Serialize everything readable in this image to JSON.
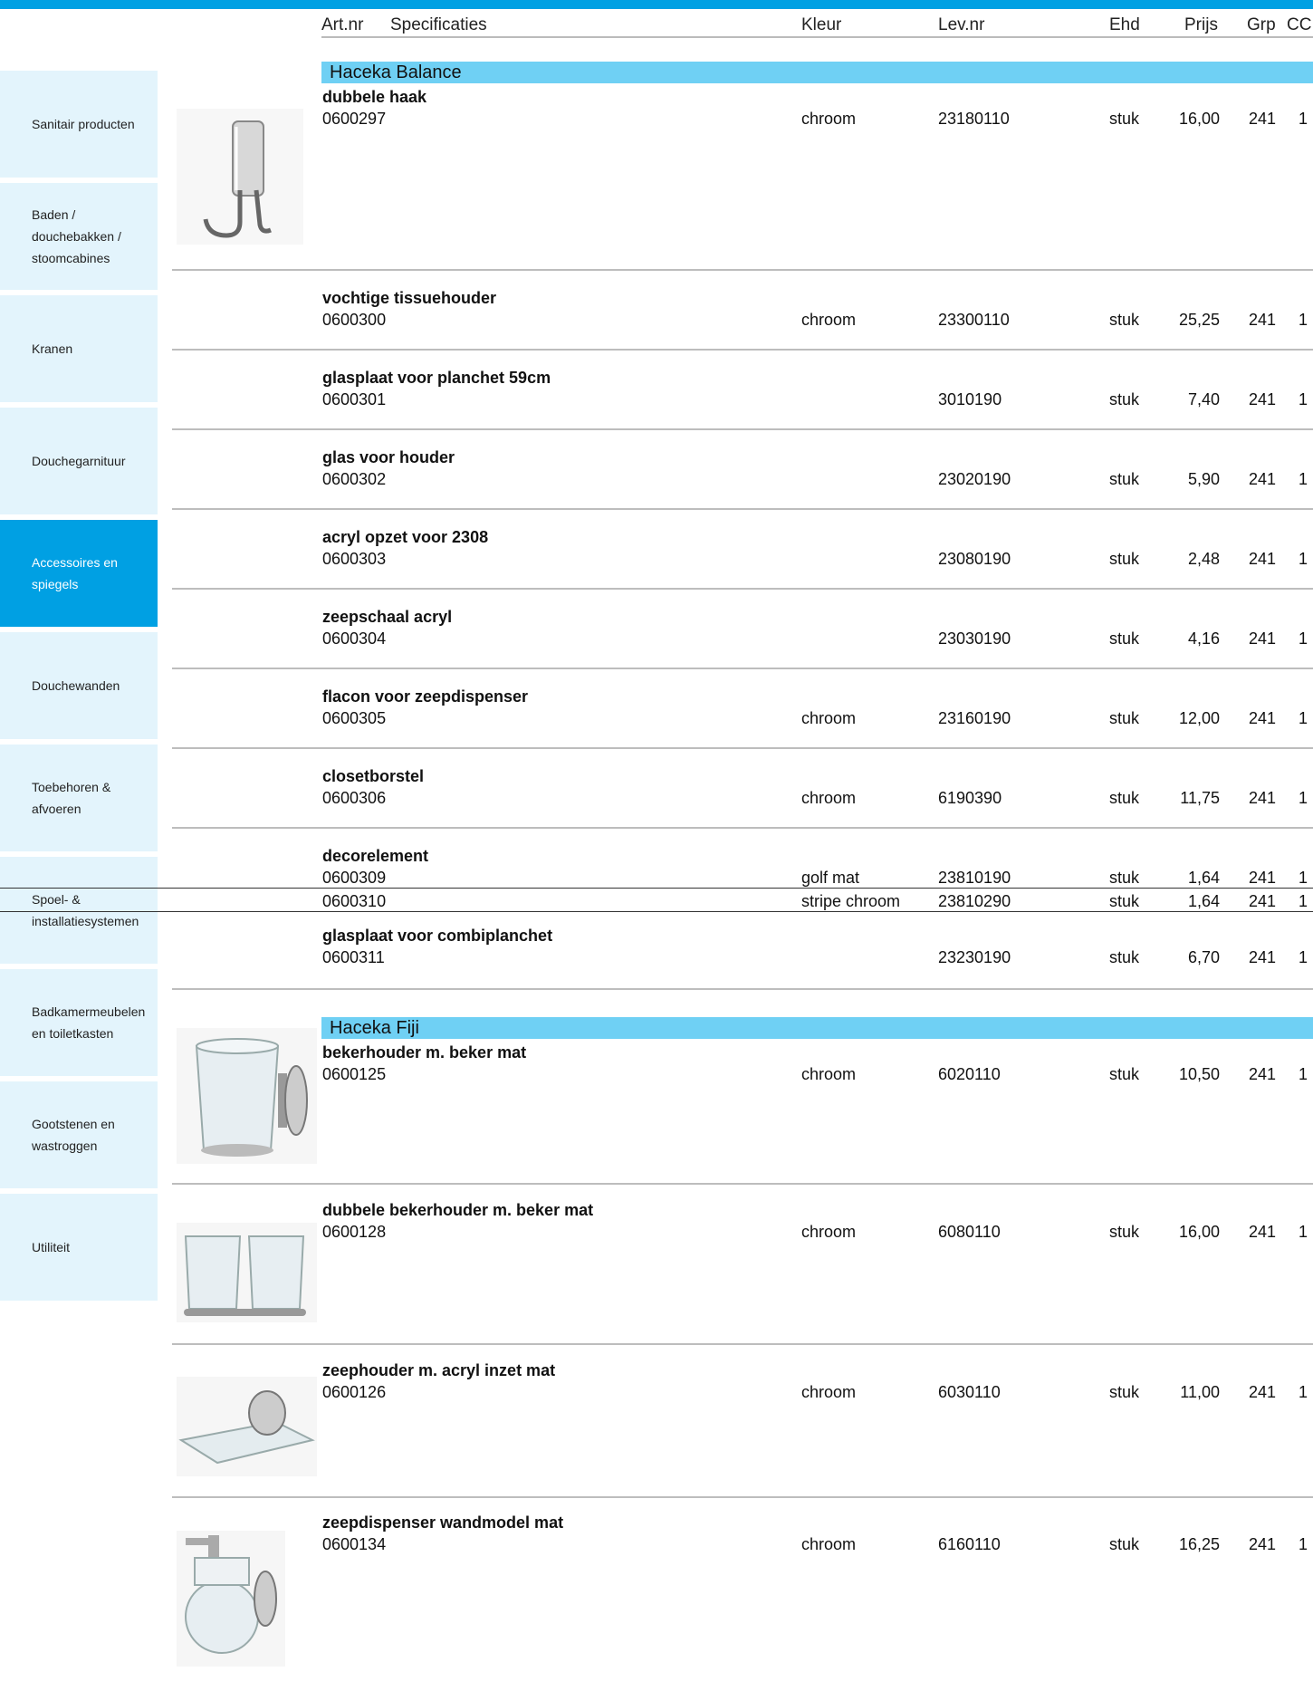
{
  "header": {
    "art_nr": "Art.nr",
    "specificaties": "Specificaties",
    "kleur": "Kleur",
    "lev_nr": "Lev.nr",
    "ehd": "Ehd",
    "prijs": "Prijs",
    "grp": "Grp",
    "cc": "CC"
  },
  "sidebar": {
    "items": [
      {
        "label": "Sanitair producten",
        "active": false
      },
      {
        "label": "Baden /\ndouchebakken /\nstoomcabines",
        "active": false
      },
      {
        "label": "Kranen",
        "active": false
      },
      {
        "label": "Douchegarnituur",
        "active": false
      },
      {
        "label": "Accessoires en\nspiegels",
        "active": true
      },
      {
        "label": "Douchewanden",
        "active": false
      },
      {
        "label": "Toebehoren &\nafvoeren",
        "active": false
      },
      {
        "label": "Spoel- &\ninstallatiesystemen",
        "active": false
      },
      {
        "label": "Badkamermeubelen\nen toiletkasten",
        "active": false
      },
      {
        "label": "Gootstenen en\nwastroggen",
        "active": false
      },
      {
        "label": "Utiliteit",
        "active": false
      }
    ]
  },
  "groups": [
    {
      "name": "Haceka Balance",
      "products": [
        {
          "title": "dubbele haak",
          "image": "hook-icon",
          "rows": [
            {
              "art": "0600297",
              "kleur": "chroom",
              "lev": "23180110",
              "ehd": "stuk",
              "prijs": "16,00",
              "grp": "241",
              "cc": "1"
            }
          ]
        },
        {
          "title": "vochtige tissuehouder",
          "rows": [
            {
              "art": "0600300",
              "kleur": "chroom",
              "lev": "23300110",
              "ehd": "stuk",
              "prijs": "25,25",
              "grp": "241",
              "cc": "1"
            }
          ]
        },
        {
          "title": "glasplaat voor planchet 59cm",
          "rows": [
            {
              "art": "0600301",
              "kleur": "",
              "lev": "3010190",
              "ehd": "stuk",
              "prijs": "7,40",
              "grp": "241",
              "cc": "1"
            }
          ]
        },
        {
          "title": "glas voor houder",
          "rows": [
            {
              "art": "0600302",
              "kleur": "",
              "lev": "23020190",
              "ehd": "stuk",
              "prijs": "5,90",
              "grp": "241",
              "cc": "1"
            }
          ]
        },
        {
          "title": "acryl opzet voor 2308",
          "rows": [
            {
              "art": "0600303",
              "kleur": "",
              "lev": "23080190",
              "ehd": "stuk",
              "prijs": "2,48",
              "grp": "241",
              "cc": "1"
            }
          ]
        },
        {
          "title": "zeepschaal acryl",
          "rows": [
            {
              "art": "0600304",
              "kleur": "",
              "lev": "23030190",
              "ehd": "stuk",
              "prijs": "4,16",
              "grp": "241",
              "cc": "1"
            }
          ]
        },
        {
          "title": "flacon voor zeepdispenser",
          "rows": [
            {
              "art": "0600305",
              "kleur": "chroom",
              "lev": "23160190",
              "ehd": "stuk",
              "prijs": "12,00",
              "grp": "241",
              "cc": "1"
            }
          ]
        },
        {
          "title": "closetborstel",
          "rows": [
            {
              "art": "0600306",
              "kleur": "chroom",
              "lev": "6190390",
              "ehd": "stuk",
              "prijs": "11,75",
              "grp": "241",
              "cc": "1"
            }
          ]
        },
        {
          "title": "decorelement",
          "rows": [
            {
              "art": "0600309",
              "kleur": "golf mat",
              "lev": "23810190",
              "ehd": "stuk",
              "prijs": "1,64",
              "grp": "241",
              "cc": "1"
            },
            {
              "art": "0600310",
              "kleur": "stripe chroom",
              "lev": "23810290",
              "ehd": "stuk",
              "prijs": "1,64",
              "grp": "241",
              "cc": "1"
            }
          ]
        },
        {
          "title": "glasplaat voor combiplanchet",
          "rows": [
            {
              "art": "0600311",
              "kleur": "",
              "lev": "23230190",
              "ehd": "stuk",
              "prijs": "6,70",
              "grp": "241",
              "cc": "1"
            }
          ]
        }
      ]
    },
    {
      "name": "Haceka Fiji",
      "products": [
        {
          "title": "bekerhouder m. beker mat",
          "image": "cup-holder-icon",
          "rows": [
            {
              "art": "0600125",
              "kleur": "chroom",
              "lev": "6020110",
              "ehd": "stuk",
              "prijs": "10,50",
              "grp": "241",
              "cc": "1"
            }
          ]
        },
        {
          "title": "dubbele bekerhouder m. beker mat",
          "image": "double-cup-holder-icon",
          "rows": [
            {
              "art": "0600128",
              "kleur": "chroom",
              "lev": "6080110",
              "ehd": "stuk",
              "prijs": "16,00",
              "grp": "241",
              "cc": "1"
            }
          ]
        },
        {
          "title": "zeephouder m. acryl inzet mat",
          "image": "soap-dish-icon",
          "rows": [
            {
              "art": "0600126",
              "kleur": "chroom",
              "lev": "6030110",
              "ehd": "stuk",
              "prijs": "11,00",
              "grp": "241",
              "cc": "1"
            }
          ]
        },
        {
          "title": "zeepdispenser wandmodel mat",
          "image": "soap-dispenser-icon",
          "rows": [
            {
              "art": "0600134",
              "kleur": "chroom",
              "lev": "6160110",
              "ehd": "stuk",
              "prijs": "16,25",
              "grp": "241",
              "cc": "1"
            }
          ]
        }
      ]
    }
  ],
  "colors": {
    "accent": "#00a0e3",
    "group_header": "#6fd0f4",
    "sidebar_bg": "#e3f4fc"
  }
}
